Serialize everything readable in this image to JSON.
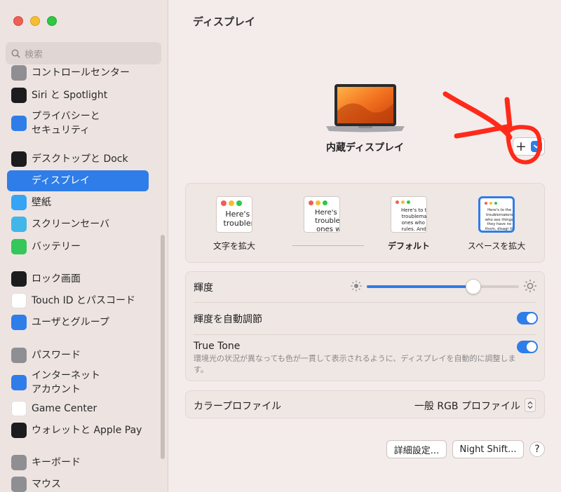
{
  "window": {
    "title": "ディスプレイ"
  },
  "search": {
    "placeholder": "検索"
  },
  "sidebar": {
    "items": [
      {
        "label": "コントロールセンター",
        "icon": "control-center-icon",
        "color": "#8e8e93"
      },
      {
        "label": "Siri と Spotlight",
        "icon": "siri-icon",
        "color": "#1c1c1e"
      },
      {
        "label": "プライバシーと",
        "label2": "セキュリティ",
        "icon": "hand-icon",
        "color": "#2f7de8"
      },
      {
        "label": "デスクトップと Dock",
        "icon": "dock-icon",
        "color": "#1c1c1e"
      },
      {
        "label": "ディスプレイ",
        "icon": "sun-icon",
        "color": "#2f7de8",
        "active": true
      },
      {
        "label": "壁紙",
        "icon": "flower-icon",
        "color": "#36a4f5"
      },
      {
        "label": "スクリーンセーバ",
        "icon": "screensaver-icon",
        "color": "#42b6e8"
      },
      {
        "label": "バッテリー",
        "icon": "battery-icon",
        "color": "#34c759"
      },
      {
        "label": "ロック画面",
        "icon": "lock-icon",
        "color": "#1c1c1e"
      },
      {
        "label": "Touch ID とパスコード",
        "icon": "fingerprint-icon",
        "color": "#ffffff"
      },
      {
        "label": "ユーザとグループ",
        "icon": "users-icon",
        "color": "#2f7de8"
      },
      {
        "label": "パスワード",
        "icon": "key-icon",
        "color": "#8e8e93"
      },
      {
        "label": "インターネット",
        "label2": "アカウント",
        "icon": "at-icon",
        "color": "#2f7de8"
      },
      {
        "label": "Game Center",
        "icon": "game-center-icon",
        "color": "#ffffff"
      },
      {
        "label": "ウォレットと Apple Pay",
        "icon": "wallet-icon",
        "color": "#1c1c1e"
      },
      {
        "label": "キーボード",
        "icon": "keyboard-icon",
        "color": "#8e8e93"
      },
      {
        "label": "マウス",
        "icon": "mouse-icon",
        "color": "#8e8e93"
      }
    ]
  },
  "main": {
    "display_name": "内蔵ディスプレイ",
    "add_label": "+",
    "resolution": {
      "options": [
        {
          "label": "文字を拡大",
          "sample": "Here's to t troublemak",
          "bold": false
        },
        {
          "label": "",
          "sample": "Here's to t troublema ones who",
          "bold": false
        },
        {
          "label": "デフォルト",
          "sample": "Here's to the cr troublemakers. ones who see t rules. And they",
          "bold": true
        },
        {
          "label": "スペースを拡大",
          "sample": "Here's to the crazy one troublemakers. The ones who see things rules. And they have no can quote them, disagr them. About the only th Because they change",
          "bold": false
        }
      ]
    },
    "brightness": {
      "label": "輝度",
      "value": 0.7
    },
    "auto_brightness": {
      "label": "輝度を自動調節",
      "on": true
    },
    "true_tone": {
      "label": "True Tone",
      "description": "環境光の状況が異なっても色が一貫して表示されるように、ディスプレイを自動的に調整します。",
      "on": true
    },
    "color_profile": {
      "label": "カラープロファイル",
      "value": "一般 RGB プロファイル"
    },
    "buttons": {
      "advanced": "詳細設定...",
      "night_shift": "Night Shift...",
      "help": "?"
    }
  },
  "colors": {
    "accent": "#2f7de8",
    "annotation": "#ff2a1a"
  }
}
